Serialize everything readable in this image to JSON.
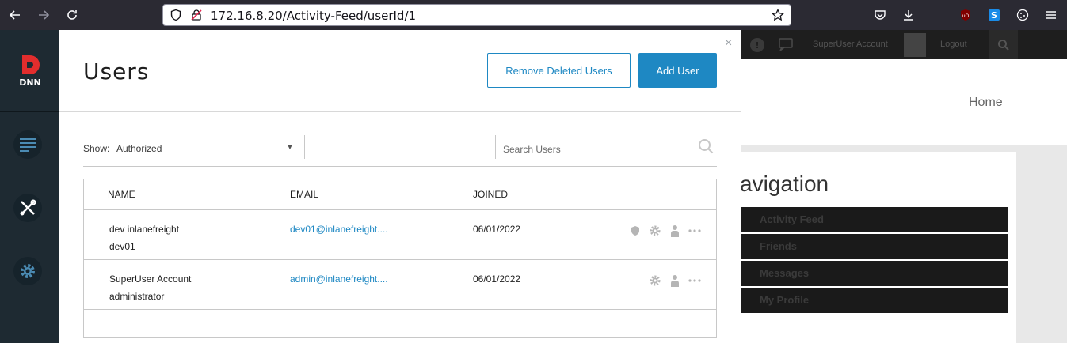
{
  "browser": {
    "url": "172.16.8.20/Activity-Feed/userId/1"
  },
  "site": {
    "topbar_user": "SuperUser Account",
    "topbar_logout": "Logout",
    "header_link": "Home",
    "panel_title": "avigation",
    "nav_items": [
      "Activity Feed",
      "Friends",
      "Messages",
      "My Profile"
    ]
  },
  "persona": {
    "logo_text": "DNN"
  },
  "modal": {
    "title": "Users",
    "remove_deleted_label": "Remove Deleted Users",
    "add_user_label": "Add User",
    "close_label": "×",
    "filter": {
      "show_label": "Show:",
      "show_value": "Authorized",
      "search_placeholder": "Search Users"
    },
    "table": {
      "headers": {
        "name": "NAME",
        "email": "EMAIL",
        "joined": "JOINED"
      },
      "rows": [
        {
          "name": "dev inlanefreight",
          "username": "dev01",
          "email": "dev01@inlanefreight....",
          "joined": "06/01/2022"
        },
        {
          "name": "SuperUser Account",
          "username": "administrator",
          "email": "admin@inlanefreight....",
          "joined": "06/01/2022"
        }
      ]
    }
  }
}
